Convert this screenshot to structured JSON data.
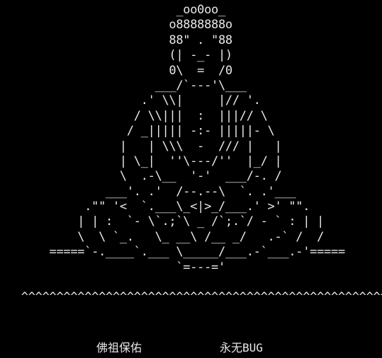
{
  "terminal": {
    "ascii_lines": [
      "                         _oo0oo_",
      "                        o8888888o",
      "                        88\" . \"88",
      "                        (| -_- |)",
      "                        0\\  =  /0",
      "                      ___/`---'\\___",
      "                    .' \\\\|     |// '.",
      "                   / \\\\|||  :  |||// \\",
      "                  / _||||| -:- |||||- \\",
      "                 |   | \\\\\\  -  /// |   |",
      "                 | \\_|  ''\\---/''  |_/ |",
      "                 \\  .-\\__  '-'  ___/-. /",
      "               ___'. .'  /--.--\\  `. .'___",
      "            .\"\" '<  `.___\\_<|>_/___.' >' \"\".",
      "           | | :  `- \\`.;`\\ _ /`;.`/ - ` : | |",
      "           \\  \\ `_.   \\_ __\\ /__ _/   .-` /  /",
      "       =====`-.____`.___ \\_____/___.-`___.-'=====",
      "                         `=---='",
      "",
      "   ^^^^^^^^^^^^^^^^^^^^^^^^^^^^^^^^^^^^^^^^^^^^^^^^^^^^^^^^^^"
    ],
    "blessing_left": "佛祖保佑",
    "blessing_right": "永无BUG"
  },
  "colors": {
    "background": "#000000",
    "text": "#e8e8e8"
  }
}
